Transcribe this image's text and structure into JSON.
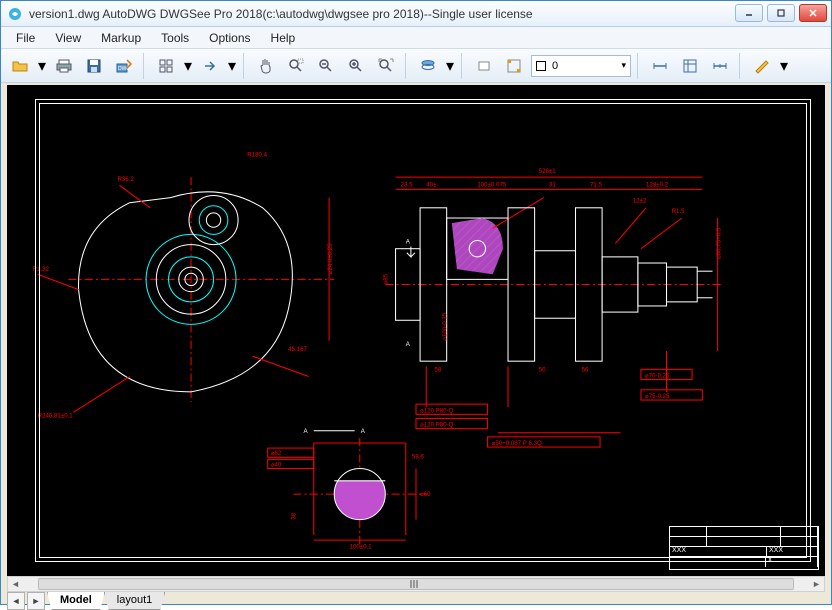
{
  "window": {
    "title": "version1.dwg AutoDWG DWGSee Pro 2018(c:\\autodwg\\dwgsee pro 2018)--Single user license"
  },
  "menu": {
    "items": [
      "File",
      "View",
      "Markup",
      "Tools",
      "Options",
      "Help"
    ]
  },
  "toolbar": {
    "layer_value": "0"
  },
  "tabs": {
    "model": "Model",
    "layout1": "layout1"
  },
  "titleblock": {
    "xxx1": "XXX",
    "xxx2": "XXX",
    "x": "X"
  },
  "drawing": {
    "section_label_a1": "A",
    "section_label_a2": "A",
    "dims": {
      "d1": "R36.2",
      "d2": "R1.32",
      "d3": "R180.4",
      "d4": "R246.81±0.1",
      "d5": "23.5",
      "d6": "40±",
      "d7": "100±0.075",
      "d8": "31",
      "d9": "71.5",
      "d10": "128±0.2",
      "d11": "528±1",
      "d12": "⌀120.P80-Q",
      "d13": "⌀120.P80-Q",
      "d14": "⌀50+0.087 P 6.3Q",
      "d15": "⌀40",
      "d16": "⌀24.0±0.25",
      "d17": "45.167",
      "d18": "12±2",
      "d19": "R1.5",
      "d20": "⌀60",
      "d21": "⌀100-0.15",
      "d22": "⌀85",
      "d23": "50",
      "d24": "58",
      "d25": "56",
      "d26": "⌀75-0.25",
      "d27": "⌀70-0.25",
      "d28": "⌀60.75+0.5",
      "d29": "⌀62",
      "d30": "58.6",
      "d31": "38",
      "d32": "100±0.1"
    }
  }
}
